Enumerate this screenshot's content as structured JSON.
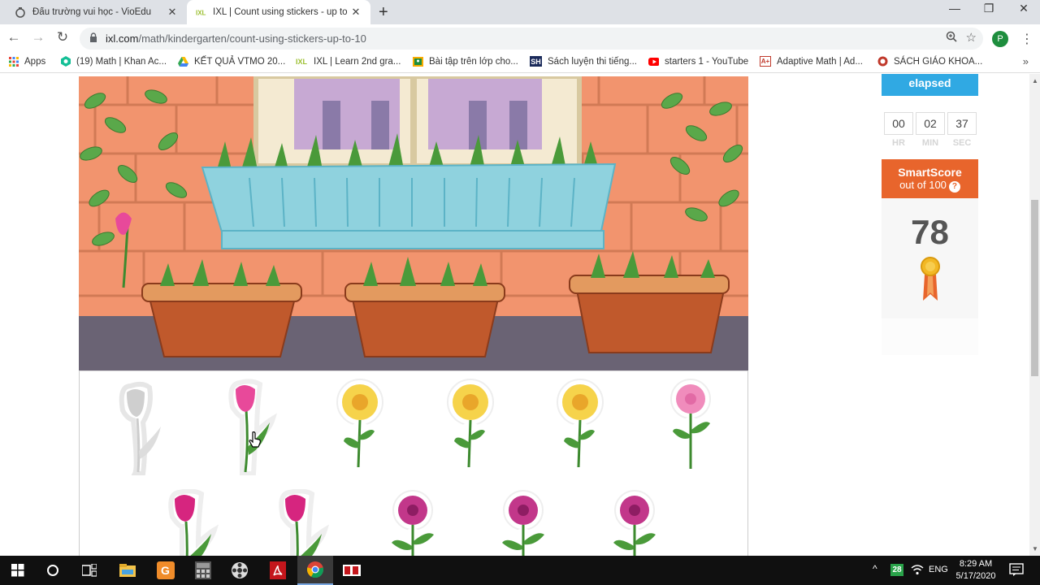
{
  "browser": {
    "tabs": [
      {
        "title": "Đấu trường vui học - VioEdu",
        "active": false
      },
      {
        "title": "IXL | Count using stickers - up to",
        "active": true
      }
    ],
    "new_tab": "+",
    "window_controls": {
      "minimize": "—",
      "restore": "❐",
      "close": "✕"
    },
    "url": {
      "host": "ixl.com",
      "path": "/math/kindergarten/count-using-stickers-up-to-10"
    },
    "profile_initial": "P",
    "bookmarks": [
      "Apps",
      "(19) Math | Khan Ac...",
      "KẾT QUẢ VTMO 20...",
      "IXL | Learn 2nd gra...",
      "Bài tập trên lớp cho...",
      "Sách luyện thi tiếng...",
      "starters 1 - YouTube",
      "Adaptive Math | Ad...",
      "SÁCH GIÁO KHOA..."
    ],
    "bookmarks_more": "»"
  },
  "timer": {
    "header": "elapsed",
    "hours": "00",
    "minutes": "02",
    "seconds": "37",
    "hours_label": "HR",
    "minutes_label": "MIN",
    "seconds_label": "SEC"
  },
  "smartscore": {
    "title": "SmartScore",
    "subtitle": "out of 100",
    "help": "?",
    "score": "78"
  },
  "stickers": {
    "row1": [
      "tulip-faded",
      "tulip-pink",
      "daisy-yellow",
      "daisy-yellow",
      "daisy-yellow",
      "daisy-pink"
    ],
    "row2": [
      "tulip-magenta",
      "tulip-magenta",
      "daisy-magenta",
      "daisy-magenta",
      "daisy-magenta"
    ]
  },
  "taskbar": {
    "time": "8:29 AM",
    "date": "5/17/2020",
    "language": "ENG",
    "badge": "28"
  },
  "colors": {
    "elapsed_blue": "#30a9e3",
    "smartscore_orange": "#e8652c",
    "wall": "#f2946e",
    "window_box": "#8fd2de",
    "pot": "#c0592c"
  }
}
